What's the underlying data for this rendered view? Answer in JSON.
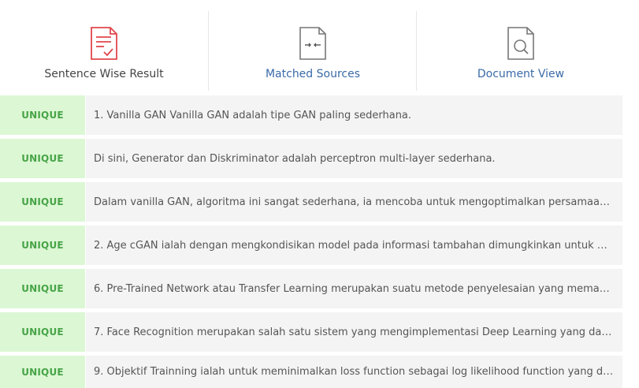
{
  "tabs": [
    {
      "label": "Sentence Wise Result",
      "icon": "report-icon",
      "color": "#444444",
      "icon_color": "#e0474c"
    },
    {
      "label": "Matched Sources",
      "icon": "compare-arrows-icon",
      "color": "#3a6aa8",
      "icon_color": "#777777"
    },
    {
      "label": "Document View",
      "icon": "document-search-icon",
      "color": "#3a6aa8",
      "icon_color": "#777777"
    }
  ],
  "rows": [
    {
      "status": "UNIQUE",
      "text": "1. Vanilla GAN Vanilla GAN adalah tipe GAN paling sederhana."
    },
    {
      "status": "UNIQUE",
      "text": "Di sini, Generator dan Diskriminator adalah perceptron multi-layer sederhana."
    },
    {
      "status": "UNIQUE",
      "text": "Dalam vanilla GAN, algoritma ini sangat sederhana, ia mencoba untuk mengoptimalkan persamaan m..."
    },
    {
      "status": "UNIQUE",
      "text": "2. Age cGAN ialah dengan mengkondisikan model pada informasi tambahan dimungkinkan untuk me..."
    },
    {
      "status": "UNIQUE",
      "text": "6. Pre-Trained Network atau Transfer Learning merupakan suatu metode penyelesaian yang memanf..."
    },
    {
      "status": "UNIQUE",
      "text": "7. Face Recognition merupakan salah satu sistem yang mengimplementasi Deep Learning yang dapa..."
    },
    {
      "status": "UNIQUE",
      "text": "9. Objektif Trainning ialah untuk meminimalkan loss function sebagai log likelihood function yang dib..."
    }
  ]
}
